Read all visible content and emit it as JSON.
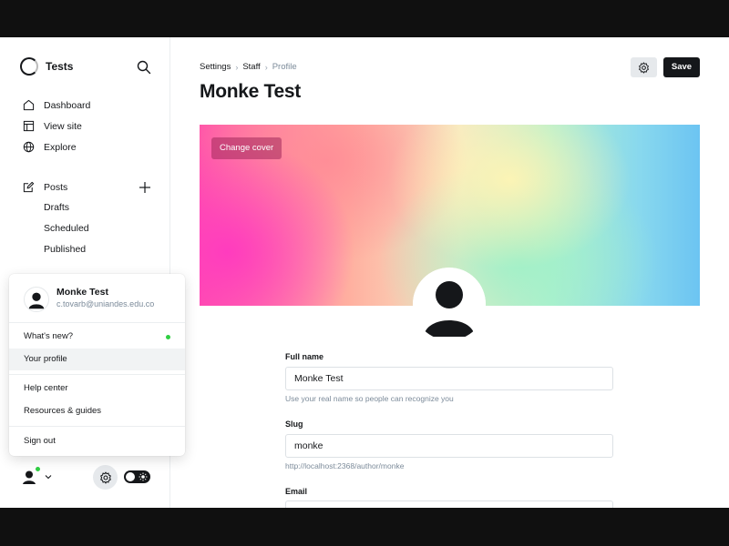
{
  "sidebar": {
    "brand_name": "Tests",
    "nav": [
      {
        "label": "Dashboard"
      },
      {
        "label": "View site"
      },
      {
        "label": "Explore"
      }
    ],
    "posts": {
      "label": "Posts",
      "sub": [
        "Drafts",
        "Scheduled",
        "Published"
      ]
    }
  },
  "popup": {
    "name": "Monke Test",
    "email": "c.tovarb@uniandes.edu.co",
    "items": {
      "whats_new": "What's new?",
      "your_profile": "Your profile",
      "help_center": "Help center",
      "resources": "Resources & guides",
      "sign_out": "Sign out"
    }
  },
  "header": {
    "breadcrumb": [
      "Settings",
      "Staff",
      "Profile"
    ],
    "title": "Monke Test",
    "save_label": "Save"
  },
  "cover": {
    "change_label": "Change cover"
  },
  "form": {
    "full_name": {
      "label": "Full name",
      "value": "Monke Test",
      "hint": "Use your real name so people can recognize you"
    },
    "slug": {
      "label": "Slug",
      "value": "monke",
      "hint": "http://localhost:2368/author/monke"
    },
    "email": {
      "label": "Email"
    }
  },
  "colors": {
    "accent": "#15171a",
    "online": "#30cf43",
    "muted": "#7c8b9a"
  },
  "icons": [
    "search-icon",
    "home-icon",
    "view-site-icon",
    "globe-icon",
    "edit-icon",
    "plus-icon",
    "gear-icon",
    "chevron-down-icon",
    "sun-icon"
  ]
}
